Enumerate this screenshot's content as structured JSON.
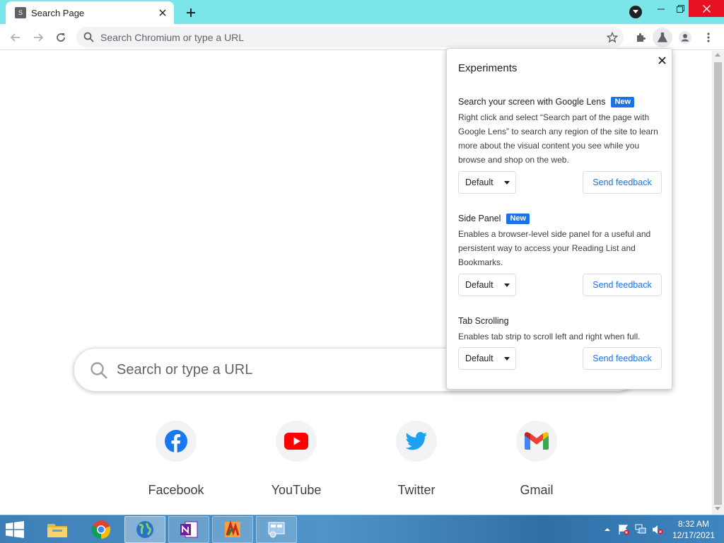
{
  "browser": {
    "tab_title": "Search Page",
    "tab_favicon_letter": "S",
    "omnibox_placeholder": "Search Chromium or type a URL",
    "icons": [
      "back-icon",
      "forward-icon",
      "reload-icon",
      "search-icon",
      "star-icon",
      "extensions-icon",
      "flask-icon",
      "profile-icon",
      "menu-icon"
    ]
  },
  "ntp": {
    "search_placeholder": "Search or type a URL",
    "shortcuts": [
      {
        "label": "Facebook",
        "icon": "facebook-icon",
        "color": "#1877f2"
      },
      {
        "label": "YouTube",
        "icon": "youtube-icon",
        "color": "#ff0000"
      },
      {
        "label": "Twitter",
        "icon": "twitter-icon",
        "color": "#1da1f2"
      },
      {
        "label": "Gmail",
        "icon": "gmail-icon",
        "color": "#ea4335"
      }
    ]
  },
  "experiments": {
    "title": "Experiments",
    "items": [
      {
        "title": "Search your screen with Google Lens",
        "badge": "New",
        "description": "Right click and select “Search part of the page with Google Lens” to search any region of the site to learn more about the visual content you see while you browse and shop on the web.",
        "select_value": "Default",
        "feedback_label": "Send feedback"
      },
      {
        "title": "Side Panel",
        "badge": "New",
        "description": "Enables a browser-level side panel for a useful and persistent way to access your Reading List and Bookmarks.",
        "select_value": "Default",
        "feedback_label": "Send feedback"
      },
      {
        "title": "Tab Scrolling",
        "badge": "",
        "description": "Enables tab strip to scroll left and right when full.",
        "select_value": "Default",
        "feedback_label": "Send feedback"
      }
    ]
  },
  "taskbar": {
    "time": "8:32 AM",
    "date": "12/17/2021",
    "apps": [
      "file-explorer-icon",
      "chrome-icon",
      "globe-icon",
      "onenote-icon",
      "paint-app-icon",
      "control-panel-icon"
    ]
  },
  "colors": {
    "tabstrip": "#7be6ea",
    "accent": "#1a73e8",
    "close_button": "#e81123"
  }
}
